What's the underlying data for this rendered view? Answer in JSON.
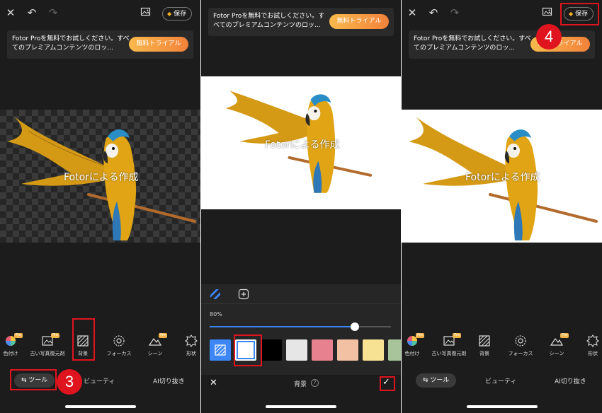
{
  "save_label": "保存",
  "promo": {
    "text": "Fotor Proを無料でお試しください。すべてのプレミアムコンテンツのロッ...",
    "button": "無料トライアル"
  },
  "watermark": "Fotorによる作成",
  "tools": [
    {
      "label": "色付け",
      "icon": "color-wheel-icon",
      "pro": true
    },
    {
      "label": "古い写真復元剤",
      "icon": "image-restore-icon",
      "pro": true
    },
    {
      "label": "背景",
      "icon": "background-hatch-icon",
      "pro": false
    },
    {
      "label": "フォーカス",
      "icon": "focus-icon",
      "pro": false
    },
    {
      "label": "シーン",
      "icon": "scene-icon",
      "pro": true
    },
    {
      "label": "形状",
      "icon": "shape-icon",
      "pro": false
    }
  ],
  "pro_badge": "Pro",
  "tabs": {
    "tools": "ツール",
    "beauty": "ビューティ",
    "ai_cutout": "AI切り抜き"
  },
  "steps": {
    "step3": "3",
    "step4": "4"
  },
  "bg_editor": {
    "opacity": "80%",
    "opacity_value": 0.8,
    "title": "背景",
    "help": "?",
    "swatches": [
      "transparent",
      "#ffffff",
      "#000000",
      "#e6e6e6",
      "#e8818f",
      "#f2c0a3",
      "#f7e294",
      "#a8c49b"
    ],
    "selected_swatch": 1
  },
  "colors": {
    "accent": "#3d86f5",
    "highlight": "#e0141e",
    "trial_start": "#f9b94c",
    "trial_end": "#f2823a"
  }
}
